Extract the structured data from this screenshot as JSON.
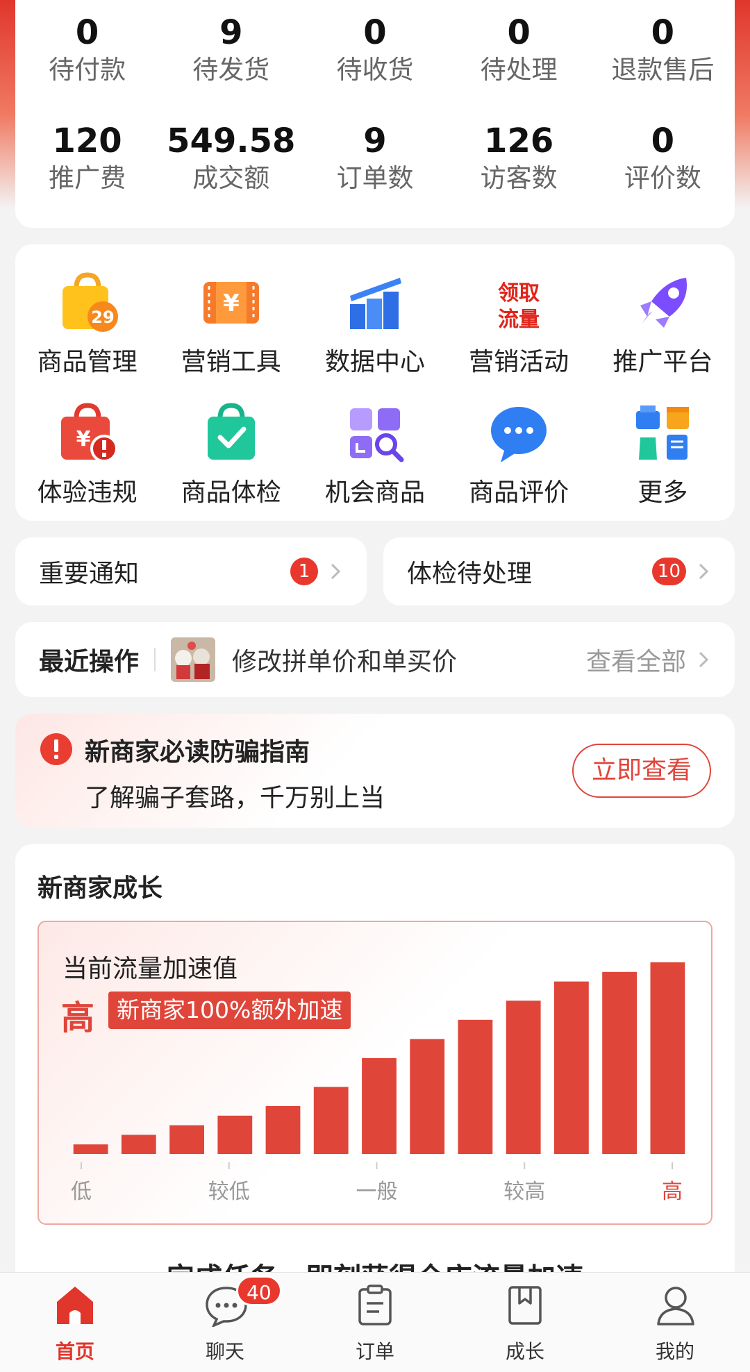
{
  "stats": {
    "row1": [
      {
        "value": "0",
        "label": "待付款"
      },
      {
        "value": "9",
        "label": "待发货"
      },
      {
        "value": "0",
        "label": "待收货"
      },
      {
        "value": "0",
        "label": "待处理"
      },
      {
        "value": "0",
        "label": "退款售后"
      }
    ],
    "row2": [
      {
        "value": "120",
        "label": "推广费"
      },
      {
        "value": "549.58",
        "label": "成交额"
      },
      {
        "value": "9",
        "label": "订单数"
      },
      {
        "value": "126",
        "label": "访客数"
      },
      {
        "value": "0",
        "label": "评价数"
      }
    ]
  },
  "tools": {
    "row1": [
      {
        "label": "商品管理",
        "icon": "product-bag-icon",
        "icon_text": "29"
      },
      {
        "label": "营销工具",
        "icon": "marketing-ticket-icon",
        "icon_text": "¥"
      },
      {
        "label": "数据中心",
        "icon": "bar-chart-icon"
      },
      {
        "label": "营销活动",
        "icon": "get-traffic-icon",
        "icon_text": "领取流量"
      },
      {
        "label": "推广平台",
        "icon": "rocket-icon"
      }
    ],
    "row2": [
      {
        "label": "体验违规",
        "icon": "violation-bag-icon",
        "icon_text": "¥"
      },
      {
        "label": "商品体检",
        "icon": "check-bag-icon"
      },
      {
        "label": "机会商品",
        "icon": "opportunity-grid-icon"
      },
      {
        "label": "商品评价",
        "icon": "chat-bubble-icon"
      },
      {
        "label": "更多",
        "icon": "more-apps-icon"
      }
    ]
  },
  "notices": {
    "important": {
      "label": "重要通知",
      "count": "1"
    },
    "checkup": {
      "label": "体检待处理",
      "count": "10"
    }
  },
  "recent": {
    "title": "最近操作",
    "desc": "修改拼单价和单买价",
    "view_all": "查看全部"
  },
  "guide": {
    "title": "新商家必读防骗指南",
    "subtitle": "了解骗子套路，千万别上当",
    "button": "立即查看"
  },
  "growth": {
    "header": "新商家成长",
    "chart_title": "当前流量加速值",
    "level": "高",
    "tag": "新商家100%额外加速",
    "tasks_peek": "完成任务，即刻获得全店流量加速"
  },
  "chart_data": {
    "type": "bar",
    "title": "当前流量加速值",
    "values": [
      5,
      10,
      15,
      20,
      25,
      35,
      50,
      60,
      70,
      80,
      90,
      95,
      100
    ],
    "ylim": [
      0,
      100
    ],
    "tick_labels": [
      "低",
      "较低",
      "一般",
      "较高",
      "高"
    ],
    "highlight_tick": "高",
    "color": "#e0453a"
  },
  "nav": {
    "items": [
      {
        "label": "首页",
        "icon": "home-icon",
        "active": true
      },
      {
        "label": "聊天",
        "icon": "chat-icon",
        "badge": "40"
      },
      {
        "label": "订单",
        "icon": "clipboard-icon"
      },
      {
        "label": "成长",
        "icon": "bookmark-book-icon"
      },
      {
        "label": "我的",
        "icon": "person-icon"
      }
    ]
  },
  "colors": {
    "brand": "#e0362c",
    "accent": "#e0453a",
    "background": "#f3f3f3"
  }
}
